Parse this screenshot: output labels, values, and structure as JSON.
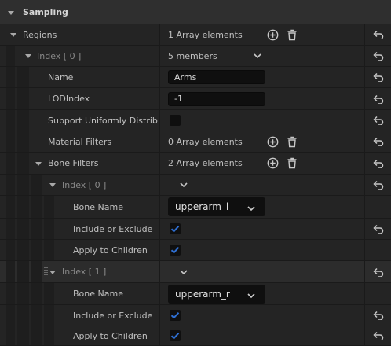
{
  "section_title": "Sampling",
  "regions": {
    "label": "Regions",
    "value": "1 Array elements"
  },
  "index0": {
    "label": "Index [ 0 ]",
    "value": "5 members"
  },
  "name": {
    "label": "Name",
    "value": "Arms"
  },
  "lod": {
    "label": "LODIndex",
    "value": "-1"
  },
  "support": {
    "label": "Support Uniformly Distrib...",
    "checked": false
  },
  "material": {
    "label": "Material Filters",
    "value": "0 Array elements"
  },
  "bone_filters": {
    "label": "Bone Filters",
    "value": "2 Array elements"
  },
  "bf0": {
    "index_label": "Index [ 0 ]",
    "bone_name_label": "Bone Name",
    "bone_name": "upperarm_l",
    "include_label": "Include or Exclude",
    "include_checked": true,
    "apply_label": "Apply to Children",
    "apply_checked": true
  },
  "bf1": {
    "index_label": "Index [ 1 ]",
    "bone_name_label": "Bone Name",
    "bone_name": "upperarm_r",
    "include_label": "Include or Exclude",
    "include_checked": true,
    "apply_label": "Apply to Children",
    "apply_checked": true
  },
  "colors": {
    "accent": "#2f6fd1",
    "panel": "#242424",
    "input": "#0f0f0f"
  }
}
